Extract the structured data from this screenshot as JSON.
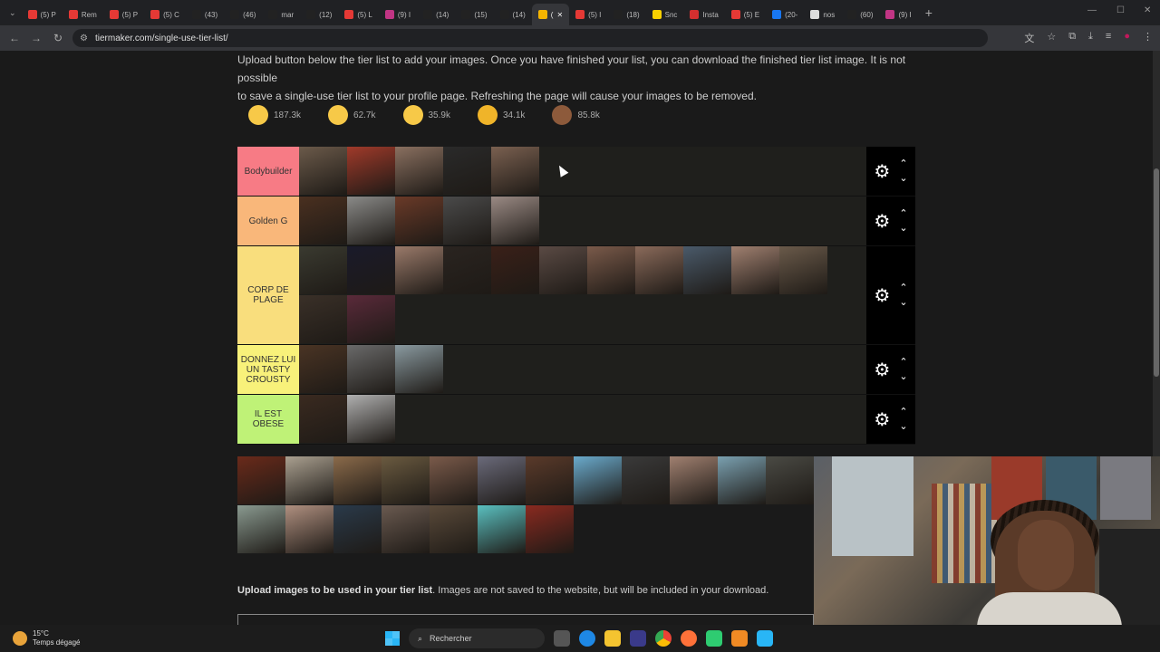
{
  "tabs": [
    {
      "label": "(5) P",
      "color": "#e53935"
    },
    {
      "label": "Rem",
      "color": "#e53935"
    },
    {
      "label": "(5) P",
      "color": "#e53935"
    },
    {
      "label": "(5) C",
      "color": "#e53935"
    },
    {
      "label": "(43)",
      "color": "#222"
    },
    {
      "label": "(46)",
      "color": "#222"
    },
    {
      "label": "mar",
      "color": "#222"
    },
    {
      "label": "(12)",
      "color": "#222"
    },
    {
      "label": "(5) L",
      "color": "#e53935"
    },
    {
      "label": "(9) I",
      "color": "#c13584"
    },
    {
      "label": "(14)",
      "color": "#222"
    },
    {
      "label": "(15)",
      "color": "#222"
    },
    {
      "label": "(14)",
      "color": "#222"
    },
    {
      "label": "(",
      "color": "#f4b400",
      "active": true
    },
    {
      "label": "(5) I",
      "color": "#e53935"
    },
    {
      "label": "(18)",
      "color": "#222"
    },
    {
      "label": "Snc",
      "color": "#f7d000"
    },
    {
      "label": "Insta",
      "color": "#d32f2f"
    },
    {
      "label": "(5) E",
      "color": "#e53935"
    },
    {
      "label": "(20-",
      "color": "#1877f2"
    },
    {
      "label": "nos",
      "color": "#ddd"
    },
    {
      "label": "(60)",
      "color": "#222"
    },
    {
      "label": "(9) I",
      "color": "#c13584"
    }
  ],
  "address": {
    "url": "tiermaker.com/single-use-tier-list/"
  },
  "intro": {
    "line1": "Upload button below the tier list to add your images. Once you have finished your list, you can download the finished tier list image. It is not possible",
    "line2": "to save a single-use tier list to your profile page. Refreshing the page will cause your images to be removed."
  },
  "reactions": [
    {
      "count": "187.3k",
      "icon": "grin-emoji",
      "color": "#f7c948"
    },
    {
      "count": "62.7k",
      "icon": "heart-eyes-emoji",
      "color": "#f7c948"
    },
    {
      "count": "35.9k",
      "icon": "laughing-emoji",
      "color": "#f7c948"
    },
    {
      "count": "34.1k",
      "icon": "raised-hands-emoji",
      "color": "#f0b429"
    },
    {
      "count": "85.8k",
      "icon": "poop-emoji",
      "color": "#8d5a3b"
    }
  ],
  "tiers": [
    {
      "label": "Bodybuilder",
      "color": "#f77b85",
      "images": [
        "#6b5a4a",
        "#a03a2a",
        "#8a7060",
        "#2a2a2a",
        "#7a6050"
      ]
    },
    {
      "label": "Golden G",
      "color": "#f9b77a",
      "images": [
        "#4a3020",
        "#8a8a88",
        "#6a3a28",
        "#4a4a4a",
        "#9a8a84"
      ]
    },
    {
      "label": "CORP DE PLAGE",
      "color": "#f9de7d",
      "images": [
        "#3a3a30",
        "#1a1a2a",
        "#9a7a6a",
        "#2a2420",
        "#3a2018",
        "#5a4a44",
        "#7a5a4a",
        "#8a6a5a",
        "#4a5a6a",
        "#a08070",
        "#6a5a4a",
        "#3a3028",
        "#5a2a3a"
      ]
    },
    {
      "label": "DONNEZ LUI UN TASTY CROUSTY",
      "color": "#f8f17a",
      "images": [
        "#4a3424",
        "#6a6a6a",
        "#8a9aa0"
      ]
    },
    {
      "label": "IL EST OBESE",
      "color": "#bff277",
      "images": [
        "#3a2a20",
        "#b0b0b0"
      ]
    }
  ],
  "pool": [
    "#6a2a1a",
    "#aaa090",
    "#8a6a4a",
    "#6a5a40",
    "#7a5a4a",
    "#6a6a7a",
    "#5a3a2a",
    "#6aaacc",
    "#3a3a3a",
    "#a08070",
    "#7aa0b0",
    "#4a4a44",
    "#8a9a90",
    "#b09080",
    "#2a3a4a",
    "#6a5a50",
    "#5a4a3a",
    "#5ac0c0",
    "#8a2a20"
  ],
  "upload": {
    "heading": "Upload images to be used in your tier list",
    "note": ". Images are not saved to the website, but will be included in your download."
  },
  "taskbar": {
    "temp": "15°C",
    "weather": "Temps dégagé",
    "search": "Rechercher"
  }
}
